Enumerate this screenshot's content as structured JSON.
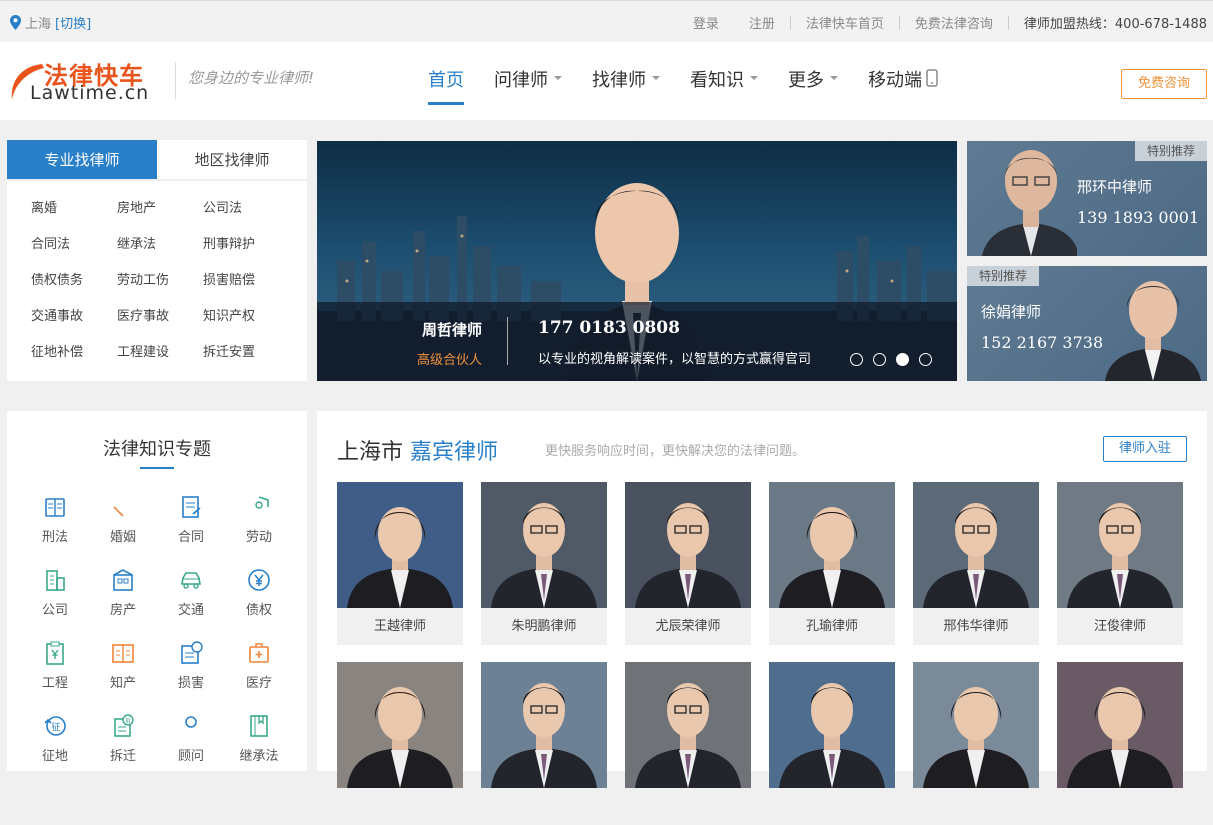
{
  "topbar": {
    "city": "上海",
    "switch": "[切换]",
    "links": [
      "登录",
      "注册",
      "法律快车首页",
      "免费法律咨询"
    ],
    "hotline": "律师加盟热线：400-678-1488"
  },
  "header": {
    "logo_cn": "法律快车",
    "logo_en": "Lawtime.cn",
    "slogan": "您身边的专业律师!",
    "nav": [
      "首页",
      "问律师",
      "找律师",
      "看知识",
      "更多",
      "移动端"
    ],
    "free_btn": "免费咨询"
  },
  "find_panel": {
    "tab_active": "专业找律师",
    "tab_other": "地区找律师",
    "categories": [
      "离婚",
      "房地产",
      "公司法",
      "合同法",
      "继承法",
      "刑事辩护",
      "债权债务",
      "劳动工伤",
      "损害赔偿",
      "交通事故",
      "医疗事故",
      "知识产权",
      "征地补偿",
      "工程建设",
      "拆迁安置"
    ]
  },
  "banner": {
    "name": "周哲律师",
    "title": "高级合伙人",
    "phone": "177 0183 0808",
    "desc": "以专业的视角解读案件，以智慧的方式赢得官司",
    "slide_count": 4,
    "current_slide": 3
  },
  "recommend": [
    {
      "tag": "特别推荐",
      "name": "邢环中律师",
      "phone": "139 1893 0001"
    },
    {
      "tag": "特别推荐",
      "name": "徐娟律师",
      "phone": "152 2167 3738"
    }
  ],
  "knowledge": {
    "title": "法律知识专题",
    "topics": [
      {
        "label": "刑法",
        "icon": "book-icon",
        "color": "#2a7fc9"
      },
      {
        "label": "婚姻",
        "icon": "hearts-icon",
        "color": "#f0843a"
      },
      {
        "label": "合同",
        "icon": "contract-icon",
        "color": "#2a7fc9"
      },
      {
        "label": "劳动",
        "icon": "shield-user-icon",
        "color": "#3aa88a"
      },
      {
        "label": "公司",
        "icon": "building-icon",
        "color": "#3aa88a"
      },
      {
        "label": "房产",
        "icon": "house-icon",
        "color": "#2a7fc9"
      },
      {
        "label": "交通",
        "icon": "car-icon",
        "color": "#3aa88a"
      },
      {
        "label": "债权",
        "icon": "yen-circle-icon",
        "color": "#2a7fc9"
      },
      {
        "label": "工程",
        "icon": "clipboard-yen-icon",
        "color": "#3aa88a"
      },
      {
        "label": "知产",
        "icon": "open-book-icon",
        "color": "#f0843a"
      },
      {
        "label": "损害",
        "icon": "compensation-icon",
        "color": "#2a7fc9"
      },
      {
        "label": "医疗",
        "icon": "medical-kit-icon",
        "color": "#f0843a"
      },
      {
        "label": "征地",
        "icon": "land-icon",
        "color": "#2a7fc9"
      },
      {
        "label": "拆迁",
        "icon": "demolish-icon",
        "color": "#3aa88a"
      },
      {
        "label": "顾问",
        "icon": "person-icon",
        "color": "#2a7fc9"
      },
      {
        "label": "继承法",
        "icon": "inherit-book-icon",
        "color": "#3aa88a"
      }
    ]
  },
  "featured": {
    "city": "上海市",
    "highlight": "嘉宾律师",
    "subtitle": "更快服务响应时间，更快解决您的法律问题。",
    "join_btn": "律师入驻",
    "lawyers_row1": [
      "王越律师",
      "朱明鹏律师",
      "尤辰荣律师",
      "孔瑜律师",
      "邢伟华律师",
      "汪俊律师"
    ],
    "row2_count": 6
  },
  "colors": {
    "accent": "#2a7fc9",
    "orange": "#f0923a",
    "brand": "#e8541c"
  }
}
